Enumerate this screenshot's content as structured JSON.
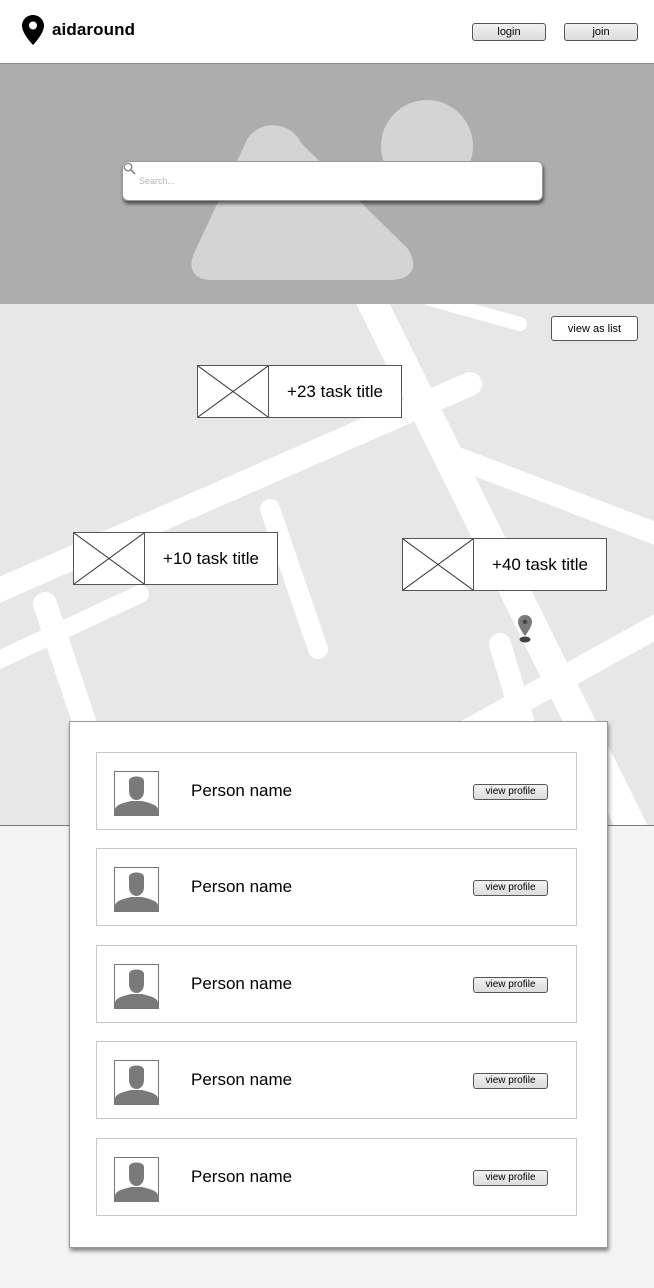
{
  "header": {
    "brand": "aidaround",
    "logo_icon": "map-pin-icon",
    "login_label": "login",
    "join_label": "join"
  },
  "hero": {
    "search": {
      "placeholder": "Search...",
      "value": "",
      "icon": "search-icon"
    }
  },
  "map": {
    "view_as_list_label": "view as list",
    "tasks": [
      {
        "title": "+23 task title"
      },
      {
        "title": "+10 task title"
      },
      {
        "title": "+40 task title"
      }
    ],
    "pin_icon": "map-marker-icon"
  },
  "people": [
    {
      "name": "Person name",
      "button_label": "view profile"
    },
    {
      "name": "Person name",
      "button_label": "view profile"
    },
    {
      "name": "Person name",
      "button_label": "view profile"
    },
    {
      "name": "Person name",
      "button_label": "view profile"
    },
    {
      "name": "Person name",
      "button_label": "view profile"
    }
  ],
  "colors": {
    "hero_bg": "#adadad",
    "map_bg": "#e7e7e7",
    "roads": "#ffffff",
    "page_bg": "#f4f4f4"
  }
}
